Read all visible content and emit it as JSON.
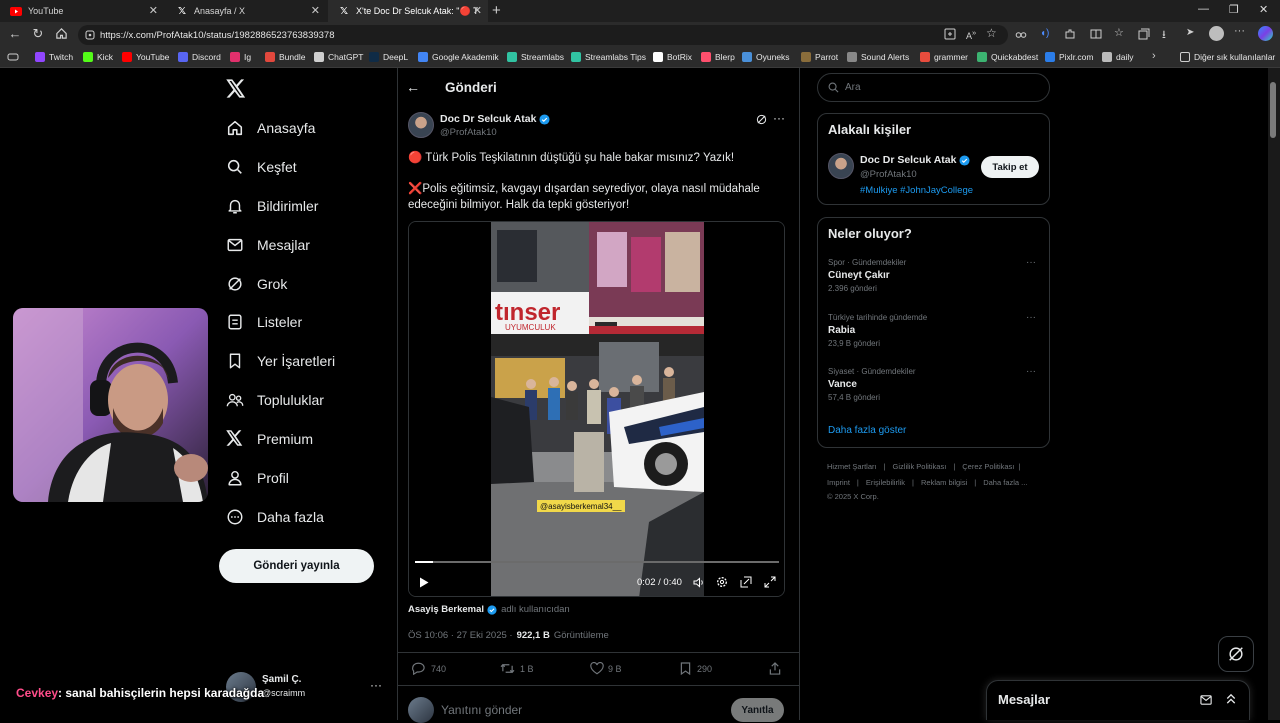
{
  "browser": {
    "tabs": [
      {
        "label": "YouTube",
        "icon": "youtube-icon"
      },
      {
        "label": "Anasayfa / X",
        "icon": "x-icon"
      },
      {
        "label": "X'te Doc Dr Selcuk Atak: \"🔴 Türk",
        "icon": "x-icon"
      }
    ],
    "url": "https://x.com/ProfAtak10/status/1982886523763839378",
    "bookmarks": [
      {
        "label": "Twitch",
        "color": "#9146ff"
      },
      {
        "label": "Kick",
        "color": "#53fc18"
      },
      {
        "label": "YouTube",
        "color": "#ff0000"
      },
      {
        "label": "Discord",
        "color": "#5865f2"
      },
      {
        "label": "Ig",
        "color": "#e1306c"
      },
      {
        "label": "Bundle",
        "color": "#e2483d"
      },
      {
        "label": "ChatGPT",
        "color": "#cfcfcf"
      },
      {
        "label": "DeepL",
        "color": "#0f2b46"
      },
      {
        "label": "Google Akademik",
        "color": "#4285f4"
      },
      {
        "label": "Streamlabs",
        "color": "#31c3a2"
      },
      {
        "label": "Streamlabs Tips",
        "color": "#31c3a2"
      },
      {
        "label": "BotRix",
        "color": "#ffffff"
      },
      {
        "label": "Blerp",
        "color": "#ff4f6d"
      },
      {
        "label": "Oyuneks",
        "color": "#4a90d9"
      },
      {
        "label": "Parrot",
        "color": "#8a6d3b"
      },
      {
        "label": "Sound Alerts",
        "color": "#888888"
      },
      {
        "label": "grammer",
        "color": "#e84c3d"
      },
      {
        "label": "Quickabdest",
        "color": "#3cb371"
      },
      {
        "label": "Pixlr.com",
        "color": "#2b7de9"
      },
      {
        "label": "daily",
        "color": "#bbbbbb"
      }
    ],
    "bookmarks_other": "Diğer sık kullanılanlar"
  },
  "sidebar": {
    "items": [
      {
        "label": "Anasayfa",
        "icon": "home-icon"
      },
      {
        "label": "Keşfet",
        "icon": "search-icon"
      },
      {
        "label": "Bildirimler",
        "icon": "bell-icon"
      },
      {
        "label": "Mesajlar",
        "icon": "mail-icon"
      },
      {
        "label": "Grok",
        "icon": "grok-icon"
      },
      {
        "label": "Listeler",
        "icon": "list-icon"
      },
      {
        "label": "Yer İşaretleri",
        "icon": "bookmark-icon"
      },
      {
        "label": "Topluluklar",
        "icon": "communities-icon"
      },
      {
        "label": "Premium",
        "icon": "x-premium-icon"
      },
      {
        "label": "Profil",
        "icon": "profile-icon"
      },
      {
        "label": "Daha fazla",
        "icon": "more-circle-icon"
      }
    ],
    "post_button": "Gönderi yayınla",
    "account": {
      "name": "Şamil Ç.",
      "handle": "@scraimm"
    }
  },
  "main": {
    "header_title": "Gönderi",
    "tweet": {
      "author_name": "Doc Dr Selcuk Atak",
      "author_handle": "@ProfAtak10",
      "line1": "🔴 Türk Polis Teşkilatının düştüğü şu hale bakar mısınız? Yazık!",
      "line2": "❌Polis eğitimsiz, kavgayı dışardan seyrediyor, olaya nasıl müdahale edeceğini bilmiyor. Halk da tepki gösteriyor!",
      "video": {
        "time": "0:02 / 0:40",
        "progress": 0.05,
        "watermark": "@asayisberkemal34__",
        "sign_text": "tınser",
        "sign_sub": "UYUMCULUK"
      },
      "attribution_name": "Asayiş Berkemal",
      "attribution_suffix": "adlı kullanıcıdan",
      "timestamp": "ÖS 10:06 · 27 Eki 2025 ·",
      "views_count": "922,1 B",
      "views_label": "Görüntüleme",
      "stats": {
        "replies": "740",
        "reposts": "1 B",
        "likes": "9 B",
        "bookmarks": "290"
      }
    },
    "reply_placeholder": "Yanıtını gönder",
    "reply_button": "Yanıtla"
  },
  "right": {
    "search_placeholder": "Ara",
    "relevant": {
      "title": "Alakalı kişiler",
      "name": "Doc Dr Selcuk Atak",
      "handle": "@ProfAtak10",
      "bio": "#Mulkiye #JohnJayCollege",
      "follow": "Takip et"
    },
    "trends": {
      "title": "Neler oluyor?",
      "items": [
        {
          "context": "Spor · Gündemdekiler",
          "name": "Cüneyt Çakır",
          "count": "2.396 gönderi"
        },
        {
          "context": "Türkiye tarihinde gündemde",
          "name": "Rabia",
          "count": "23,9 B gönderi"
        },
        {
          "context": "Siyaset · Gündemdekiler",
          "name": "Vance",
          "count": "57,4 B gönderi"
        }
      ],
      "more": "Daha fazla göster"
    },
    "footer": {
      "row1": [
        "Hizmet Şartları",
        "Gizlilik Politikası",
        "Çerez Politikası"
      ],
      "row2": [
        "Imprint",
        "Erişilebilirlik",
        "Reklam bilgisi",
        "Daha fazla ..."
      ],
      "copyright": "© 2025 X Corp."
    }
  },
  "overlay": {
    "chat_user": "Cevkey",
    "chat_message": ": sanal bahisçilerin hepsi karadağda"
  },
  "messages_bar": {
    "title": "Mesajlar"
  },
  "colors": {
    "accent": "#1d9bf0",
    "background": "#000000",
    "border": "#2f3336",
    "muted": "#71767b",
    "chat_user": "#ff4d8a"
  }
}
